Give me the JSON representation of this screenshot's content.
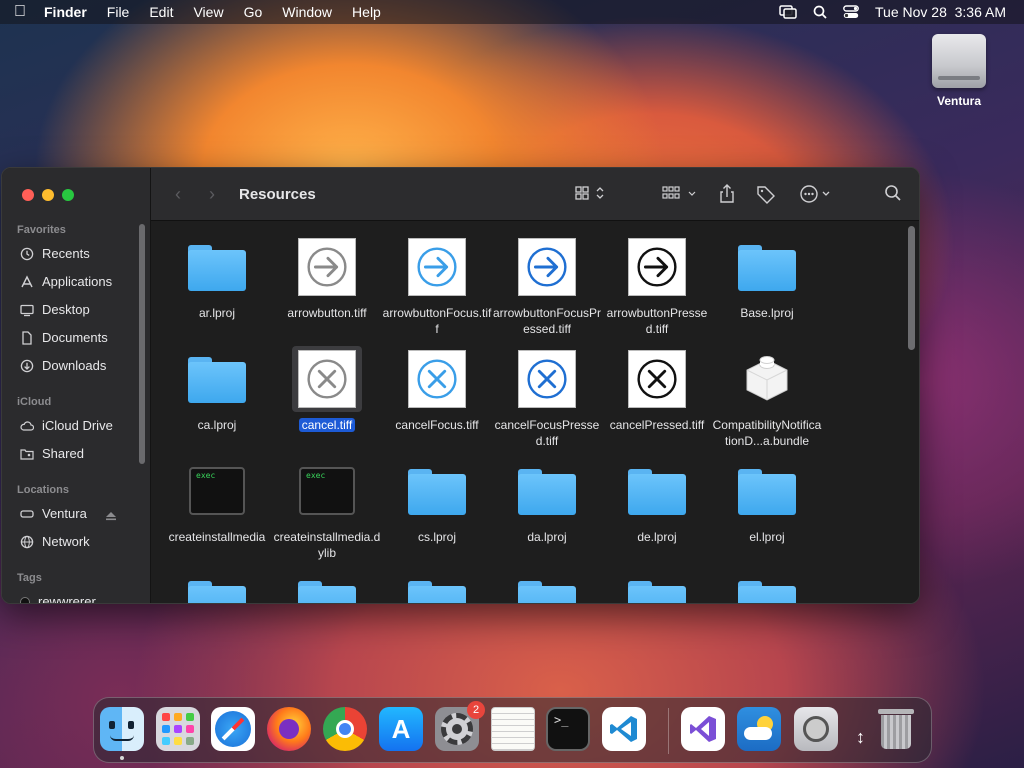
{
  "menubar": {
    "app_name": "Finder",
    "menus": [
      "File",
      "Edit",
      "View",
      "Go",
      "Window",
      "Help"
    ],
    "datetime": "Tue Nov 28  3:36 AM"
  },
  "desktop": {
    "drive_label": "Ventura"
  },
  "finder": {
    "title": "Resources",
    "sidebar": {
      "favorites_header": "Favorites",
      "favorites": [
        {
          "label": "Recents",
          "icon": "clock-icon"
        },
        {
          "label": "Applications",
          "icon": "applications-icon"
        },
        {
          "label": "Desktop",
          "icon": "desktop-icon"
        },
        {
          "label": "Documents",
          "icon": "document-icon"
        },
        {
          "label": "Downloads",
          "icon": "download-icon"
        }
      ],
      "icloud_header": "iCloud",
      "icloud": [
        {
          "label": "iCloud Drive",
          "icon": "cloud-icon"
        },
        {
          "label": "Shared",
          "icon": "shared-folder-icon"
        }
      ],
      "locations_header": "Locations",
      "locations": [
        {
          "label": "Ventura",
          "icon": "disk-icon"
        },
        {
          "label": "Network",
          "icon": "network-icon"
        }
      ],
      "tags_header": "Tags",
      "tags": [
        {
          "label": "rewwrerer",
          "color": "#111111"
        }
      ]
    },
    "files": [
      {
        "name": "ar.lproj",
        "kind": "folder"
      },
      {
        "name": "arrowbutton.tiff",
        "kind": "arrow",
        "style": "gray"
      },
      {
        "name": "arrowbuttonFocus.tiff",
        "kind": "arrow",
        "style": "lightblue"
      },
      {
        "name": "arrowbuttonFocusPressed.tiff",
        "kind": "arrow",
        "style": "blue"
      },
      {
        "name": "arrowbuttonPressed.tiff",
        "kind": "arrow",
        "style": "black"
      },
      {
        "name": "Base.lproj",
        "kind": "folder"
      },
      {
        "name": "ca.lproj",
        "kind": "folder"
      },
      {
        "name": "cancel.tiff",
        "kind": "cancel",
        "style": "gray",
        "selected": true
      },
      {
        "name": "cancelFocus.tiff",
        "kind": "cancel",
        "style": "lightblue"
      },
      {
        "name": "cancelFocusPressed.tiff",
        "kind": "cancel",
        "style": "blue"
      },
      {
        "name": "cancelPressed.tiff",
        "kind": "cancel",
        "style": "black"
      },
      {
        "name": "CompatibilityNotificationD...a.bundle",
        "kind": "bundle"
      },
      {
        "name": "createinstallmedia",
        "kind": "exec"
      },
      {
        "name": "createinstallmedia.dylib",
        "kind": "exec"
      },
      {
        "name": "cs.lproj",
        "kind": "folder"
      },
      {
        "name": "da.lproj",
        "kind": "folder"
      },
      {
        "name": "de.lproj",
        "kind": "folder"
      },
      {
        "name": "el.lproj",
        "kind": "folder"
      },
      {
        "name": "",
        "kind": "folder"
      },
      {
        "name": "",
        "kind": "folder"
      },
      {
        "name": "",
        "kind": "folder"
      },
      {
        "name": "",
        "kind": "folder"
      },
      {
        "name": "",
        "kind": "folder"
      },
      {
        "name": "",
        "kind": "folder"
      }
    ],
    "exec_text": "exec"
  },
  "dock": {
    "apps": [
      {
        "name": "Finder",
        "icon": "finder-icon",
        "running": true
      },
      {
        "name": "Launchpad",
        "icon": "launchpad-icon",
        "running": false
      },
      {
        "name": "Safari",
        "icon": "safari-icon",
        "running": false
      },
      {
        "name": "Firefox",
        "icon": "firefox-icon",
        "running": false
      },
      {
        "name": "Chrome",
        "icon": "chrome-icon",
        "running": false
      },
      {
        "name": "App Store",
        "icon": "app-store-icon",
        "running": false
      },
      {
        "name": "System Settings",
        "icon": "settings-icon",
        "running": false,
        "badge": "2"
      },
      {
        "name": "TextEdit",
        "icon": "textedit-icon",
        "running": false
      },
      {
        "name": "Terminal",
        "icon": "terminal-icon",
        "running": false
      },
      {
        "name": "VS Code",
        "icon": "vscode-icon",
        "running": false
      },
      {
        "name": "Visual Studio",
        "icon": "visual-studio-icon",
        "running": false
      },
      {
        "name": "Weather",
        "icon": "weather-icon",
        "running": false
      },
      {
        "name": "Disk Utility",
        "icon": "disk-utility-icon",
        "running": false
      },
      {
        "name": "Trash",
        "icon": "trash-icon",
        "running": false
      }
    ]
  }
}
